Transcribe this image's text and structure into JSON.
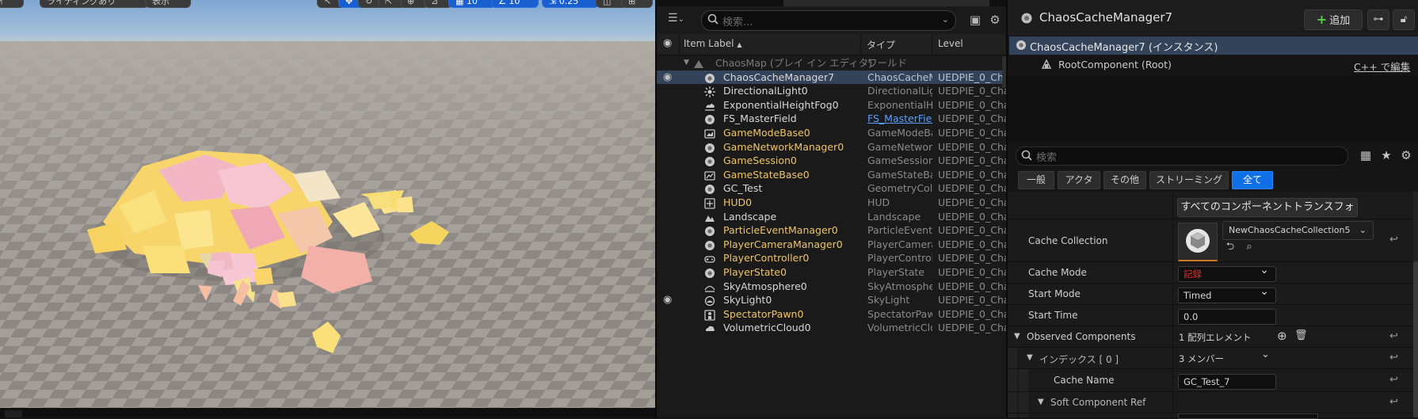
{
  "viewport": {
    "toolbar": [
      "ライティングあり",
      "表示"
    ],
    "toolbar_num1": "10",
    "toolbar_num2": "10",
    "toolbar_speed": "0.25"
  },
  "outliner": {
    "search_placeholder": "検索...",
    "columns": {
      "label": "Item Label",
      "sort_icon": "▲",
      "type": "タイプ",
      "level": "Level"
    },
    "rows": [
      {
        "name": "ChaosMap (プレイ イン エディタ)",
        "type": "ワールド",
        "level": "",
        "icon": "map-icon",
        "map": true
      },
      {
        "name": "ChaosCacheManager7",
        "type": "ChaosCacheM",
        "level": "UEDPIE_0_Cha",
        "icon": "actor-icon",
        "selected": true,
        "eye": true
      },
      {
        "name": "DirectionalLight0",
        "type": "DirectionalLigh",
        "level": "UEDPIE_0_Cha",
        "icon": "sun-icon"
      },
      {
        "name": "ExponentialHeightFog0",
        "type": "ExponentialHei",
        "level": "UEDPIE_0_Cha",
        "icon": "fog-icon"
      },
      {
        "name": "FS_MasterField",
        "type": "FS_MasterFiel",
        "level": "UEDPIE_0_Cha",
        "icon": "actor-icon",
        "type_link": true
      },
      {
        "name": "GameModeBase0",
        "type": "GameModeBas",
        "level": "UEDPIE_0_Cha",
        "icon": "gamemode-icon",
        "gold": true
      },
      {
        "name": "GameNetworkManager0",
        "type": "GameNetwork",
        "level": "UEDPIE_0_Cha",
        "icon": "actor-icon",
        "gold": true
      },
      {
        "name": "GameSession0",
        "type": "GameSession",
        "level": "UEDPIE_0_Cha",
        "icon": "actor-icon",
        "gold": true
      },
      {
        "name": "GameStateBase0",
        "type": "GameStateBas",
        "level": "UEDPIE_0_Cha",
        "icon": "gamestate-icon",
        "gold": true
      },
      {
        "name": "GC_Test",
        "type": "GeometryColle",
        "level": "UEDPIE_0_Cha",
        "icon": "actor-icon"
      },
      {
        "name": "HUD0",
        "type": "HUD",
        "level": "UEDPIE_0_Cha",
        "icon": "hud-icon",
        "gold": true
      },
      {
        "name": "Landscape",
        "type": "Landscape",
        "level": "UEDPIE_0_Cha",
        "icon": "landscape-icon"
      },
      {
        "name": "ParticleEventManager0",
        "type": "ParticleEventM",
        "level": "UEDPIE_0_Cha",
        "icon": "actor-icon",
        "gold": true
      },
      {
        "name": "PlayerCameraManager0",
        "type": "PlayerCameral",
        "level": "UEDPIE_0_Cha",
        "icon": "actor-icon",
        "gold": true
      },
      {
        "name": "PlayerController0",
        "type": "PlayerControlle",
        "level": "UEDPIE_0_Cha",
        "icon": "gamepad-icon",
        "gold": true
      },
      {
        "name": "PlayerState0",
        "type": "PlayerState",
        "level": "UEDPIE_0_Cha",
        "icon": "actor-icon",
        "gold": true
      },
      {
        "name": "SkyAtmosphere0",
        "type": "SkyAtmospher",
        "level": "UEDPIE_0_Cha",
        "icon": "sky-icon"
      },
      {
        "name": "SkyLight0",
        "type": "SkyLight",
        "level": "UEDPIE_0_Cha",
        "icon": "skylight-icon",
        "eye": true
      },
      {
        "name": "SpectatorPawn0",
        "type": "SpectatorPawı",
        "level": "UEDPIE_0_Cha",
        "icon": "pawn-icon",
        "gold": true
      },
      {
        "name": "VolumetricCloud0",
        "type": "VolumetricClou",
        "level": "UEDPIE_0_Cha",
        "icon": "cloud-icon"
      }
    ]
  },
  "details": {
    "title": "ChaosCacheManager7",
    "add_label": "追加",
    "instance_label": "ChaosCacheManager7 (インスタンス)",
    "root_label": "RootComponent (Root)",
    "cpp_link": "C++ で編集",
    "search_placeholder": "検索",
    "filters": [
      "一般",
      "アクタ",
      "その他",
      "ストリーミング",
      "全て"
    ],
    "transform_button": "すべてのコンポーネントトランスフォーム",
    "props": {
      "cache_collection": {
        "label": "Cache Collection",
        "value": "NewChaosCacheCollection5"
      },
      "cache_mode": {
        "label": "Cache Mode",
        "value": "記録"
      },
      "start_mode": {
        "label": "Start Mode",
        "value": "Timed"
      },
      "start_time": {
        "label": "Start Time",
        "value": "0.0"
      },
      "observed": {
        "label": "Observed Components",
        "value": "1 配列エレメント"
      },
      "index0": {
        "label": "インデックス [ 0 ]",
        "value": "3 メンバー"
      },
      "cache_name": {
        "label": "Cache Name",
        "value": "GC_Test_7"
      },
      "soft_ref": {
        "label": "Soft Component Ref"
      }
    }
  }
}
